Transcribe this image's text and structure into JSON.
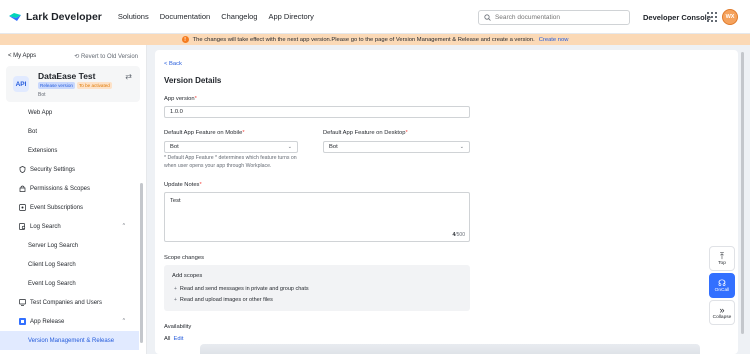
{
  "nav": {
    "brand": "Lark Developer",
    "links": [
      "Solutions",
      "Documentation",
      "Changelog",
      "App Directory"
    ],
    "search_placeholder": "Search documentation",
    "console": "Developer Console",
    "avatar": "WX"
  },
  "banner": {
    "text": "The changes will take effect with the next app version.Please go to the page of Version Management & Release and create a version.",
    "link": "Create now"
  },
  "sidebar": {
    "my_apps": "< My Apps",
    "revert": "Revert to Old Version",
    "app_icon": "API",
    "app_name": "DataEase Test",
    "tag_release": "Release version",
    "tag_status": "To be activated",
    "app_sub": "Bot",
    "items": [
      {
        "label": "Web App"
      },
      {
        "label": "Bot"
      },
      {
        "label": "Extensions"
      },
      {
        "label": "Security Settings"
      },
      {
        "label": "Permissions & Scopes"
      },
      {
        "label": "Event Subscriptions"
      },
      {
        "label": "Log Search"
      },
      {
        "label": "Server Log Search"
      },
      {
        "label": "Client Log Search"
      },
      {
        "label": "Event Log Search"
      },
      {
        "label": "Test Companies and Users"
      },
      {
        "label": "App Release"
      },
      {
        "label": "Version Management & Release"
      }
    ]
  },
  "main": {
    "back": "Back",
    "title": "Version Details",
    "app_version_label": "App version",
    "app_version_value": "1.0.0",
    "mobile_label": "Default App Feature on Mobile",
    "mobile_value": "Bot",
    "desktop_label": "Default App Feature on Desktop",
    "desktop_value": "Bot",
    "hint_line1": "* Default App Feature * determines which feature turns on",
    "hint_line2": "when user opens your app through Workplace.",
    "notes_label": "Update Notes",
    "notes_value": "Test",
    "notes_count": "4",
    "notes_max": "/500",
    "scope_label": "Scope changes",
    "scope_head": "Add scopes",
    "scopes": [
      "Read and send messages in private and group chats",
      "Read and upload images or other files"
    ],
    "availability_label": "Availability",
    "availability_value": "All",
    "availability_edit": "Edit"
  },
  "tools": {
    "top": "Top",
    "oncall": "OnCall",
    "collapse": "Collapse"
  },
  "colors": {
    "accent": "#3370ff",
    "link": "#245bdb",
    "banner": "#fbd9b6"
  }
}
